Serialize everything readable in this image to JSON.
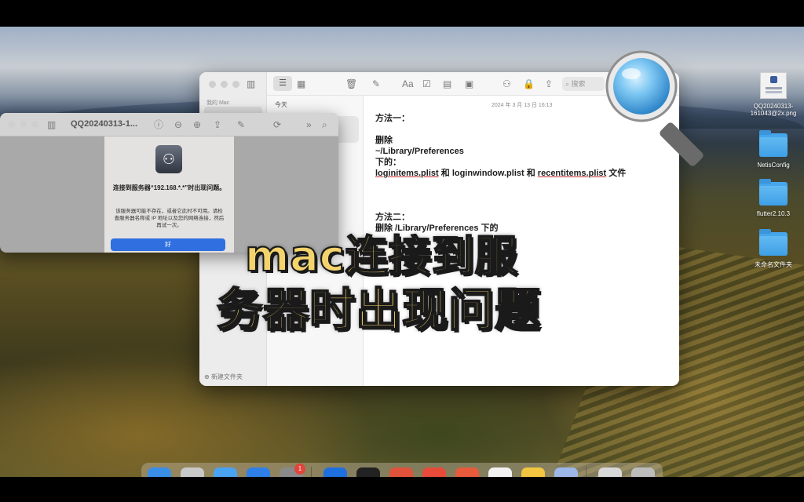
{
  "notes_window": {
    "sidebar_label": "我的 Mac",
    "sidebar_new_folder": "新建文件夹",
    "list_section": "今天",
    "search_placeholder": "搜索",
    "format_label": "Aa",
    "note_date": "2024 年 3 月 13 日 16:13",
    "note_lines": {
      "l1": "方法一：",
      "l2": "删除",
      "l3": "~/Library/Preferences",
      "l4": "下的：",
      "l5a": "loginitems.plist",
      "l5b": " 和 ",
      "l5c": "loginwindow.plist",
      "l5d": " 和 ",
      "l5e": "recentitems.plist",
      "l5f": " 文件",
      "l6": "方法二：",
      "l7": "删除 /Library/Preferences 下的"
    }
  },
  "finder_window": {
    "title": "QQ20240313-1...",
    "dialog": {
      "icon": "server-icon",
      "title": "连接到服务器“192.168.*.*”时出现问题。",
      "message": "该服务器可能不存在，或者它此时不可用。请检查服务器名称或 IP 地址以及您的网络连接，然后再试一次。",
      "ok_label": "好"
    }
  },
  "desktop_icons": [
    {
      "label": "QQ20240313-161043@2x.png",
      "type": "png"
    },
    {
      "label": "NetisConfig",
      "type": "folder"
    },
    {
      "label": "flutter2.10.3",
      "type": "folder"
    },
    {
      "label": "未命名文件夹",
      "type": "folder"
    }
  ],
  "overlay_title": {
    "line1": "mac连接到服",
    "line2": "务器时出现问题"
  },
  "dock": {
    "badge_count": "1",
    "apps": [
      "finder",
      "launchpad",
      "safari",
      "app-store",
      "system-settings",
      "xcode",
      "terminal",
      "git",
      "toolbox",
      "chrome",
      "notion",
      "notes",
      "preview",
      "downloads",
      "trash"
    ]
  },
  "colors": {
    "overlay_text": "#f3d36b",
    "dialog_button": "#2f6fe0",
    "folder": "#45a6ec"
  }
}
